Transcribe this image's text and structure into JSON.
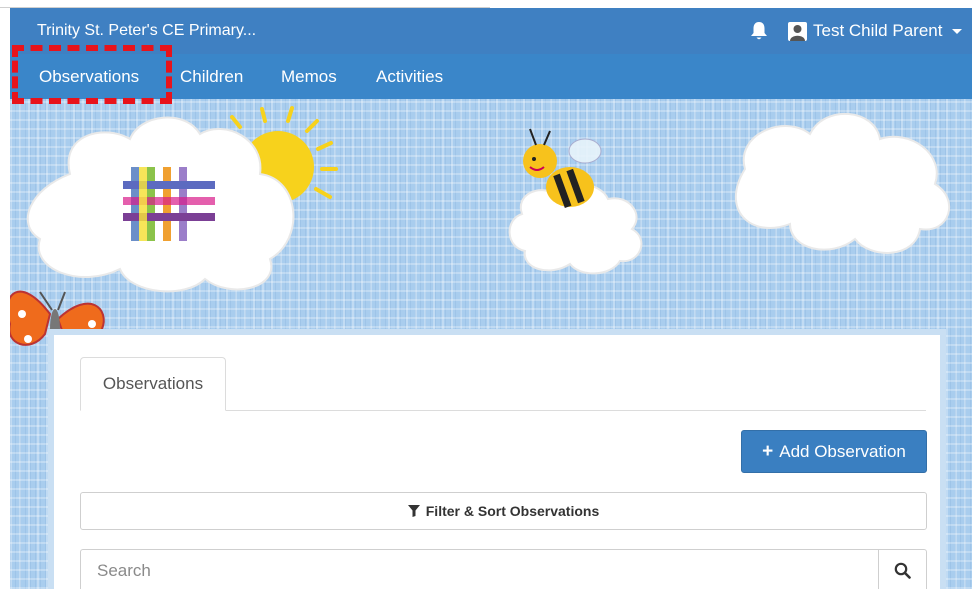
{
  "header": {
    "school_name": "Trinity St. Peter's CE Primary...",
    "user_name": "Test Child Parent",
    "bell_icon": "bell-icon",
    "avatar_icon": "user-avatar-icon"
  },
  "nav": {
    "items": [
      {
        "label": "Observations",
        "active": true
      },
      {
        "label": "Children"
      },
      {
        "label": "Memos"
      },
      {
        "label": "Activities"
      }
    ]
  },
  "content": {
    "tab_label": "Observations",
    "add_button": "Add Observation",
    "filter_button": "Filter & Sort Observations",
    "search_placeholder": "Search",
    "icons": {
      "add": "plus-icon",
      "filter": "filter-icon",
      "search": "search-icon"
    }
  },
  "colors": {
    "topbar": "#3f80c2",
    "navbar": "#3a86c9",
    "primary_button": "#3a7fc1",
    "highlight": "#e8131b",
    "background": "#a9cdee"
  }
}
